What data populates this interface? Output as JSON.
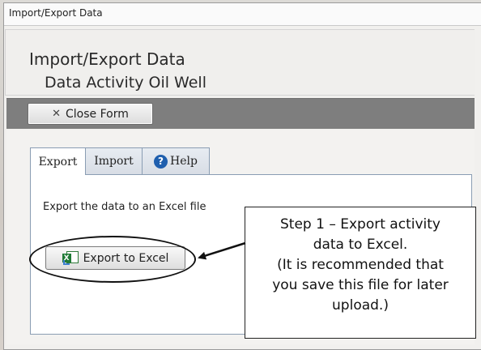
{
  "window": {
    "title": "Import/Export Data"
  },
  "header": {
    "title": "Import/Export Data",
    "subtitle": "Data Activity Oil Well"
  },
  "toolbar": {
    "close_label": "Close Form"
  },
  "tabs": [
    {
      "label": "Export",
      "active": true
    },
    {
      "label": "Import",
      "active": false
    },
    {
      "label": "Help",
      "active": false
    }
  ],
  "panel": {
    "description": "Export the data to an Excel file",
    "export_button_label": "Export to Excel"
  },
  "callout": {
    "lines": [
      "Step 1 – Export activity",
      "data to Excel.",
      "(It is recommended that",
      "you save this file for later",
      "upload.)"
    ]
  },
  "icons": {
    "close": "close-icon",
    "help": "help-icon",
    "excel": "excel-export-icon"
  },
  "colors": {
    "toolbar_bg": "#7e7e7e",
    "help_icon": "#1f5fae",
    "excel_green": "#1f7a35",
    "tab_border": "#8a9db3"
  }
}
